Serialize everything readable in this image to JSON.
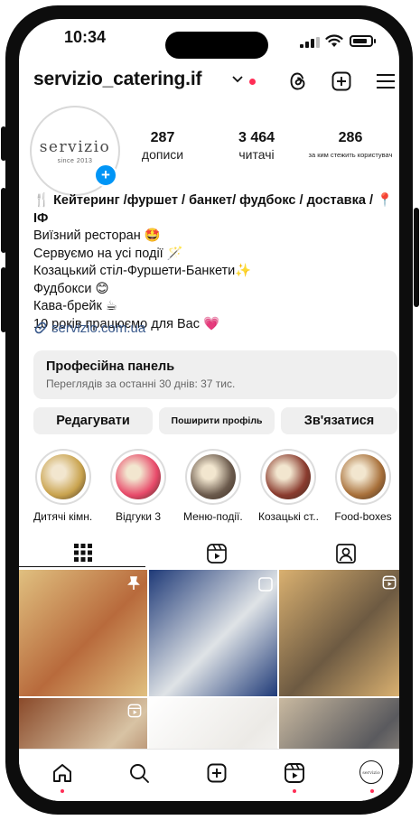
{
  "status": {
    "time": "10:34"
  },
  "header": {
    "username": "servizio_catering.if",
    "icons": [
      "threads-icon",
      "plus-square-icon",
      "menu-icon"
    ]
  },
  "avatar": {
    "logo_text": "servizio",
    "logo_sub": "since 2013"
  },
  "stats": [
    {
      "value": "287",
      "label": "дописи"
    },
    {
      "value": "3 464",
      "label": "читачі"
    },
    {
      "value": "286",
      "label": "за ким стежить користувач"
    }
  ],
  "bio": {
    "title": "🍴 Кейтеринг /фуршет / банкет/ фудбокс / доставка / 📍ІФ",
    "lines": [
      "Виїзний ресторан 🤩",
      "Сервуємо на усі події 🪄",
      "Козацький стіл-Фуршети-Банкети✨",
      "Фудбокси 😊",
      "Кава-брейк ☕",
      "10 років працюємо для Вас 💗"
    ],
    "link": "servizio.com.ua"
  },
  "panel": {
    "title": "Професійна панель",
    "subtitle": "Переглядів за останні 30 днів: 37 тис."
  },
  "actions": {
    "edit": "Редагувати",
    "share": "Поширити профіль",
    "contact": "Зв'язатися"
  },
  "highlights": [
    {
      "label": "Дитячі кімн...",
      "color": "#c9a34e"
    },
    {
      "label": "Відгуки 3",
      "color": "#e84a6a"
    },
    {
      "label": "Меню-події...",
      "color": "#6b5a4c"
    },
    {
      "label": "Козацькі ст...",
      "color": "#8a3b2e"
    },
    {
      "label": "Food-boxes",
      "color": "#a8703a"
    }
  ],
  "tabs": [
    "grid-icon",
    "reels-icon",
    "tagged-icon"
  ],
  "grid": [
    {
      "color": "#b86a3c",
      "accent": "#e0c080",
      "badge": "pin-icon"
    },
    {
      "color": "#dfe3e6",
      "accent": "#1f3a78",
      "badge": "square-icon"
    },
    {
      "color": "#6d5a42",
      "accent": "#d9b070",
      "badge": "reels-icon"
    },
    {
      "color": "#d8c3a4",
      "accent": "#8a4a2a",
      "badge": "reels-icon"
    },
    {
      "color": "#eceae6",
      "accent": "#ffffff",
      "badge": ""
    },
    {
      "color": "#5a5a5e",
      "accent": "#c9b9a0",
      "badge": ""
    }
  ],
  "bottom_nav": [
    "home-icon",
    "search-icon",
    "create-icon",
    "reels-icon",
    "profile-avatar"
  ]
}
